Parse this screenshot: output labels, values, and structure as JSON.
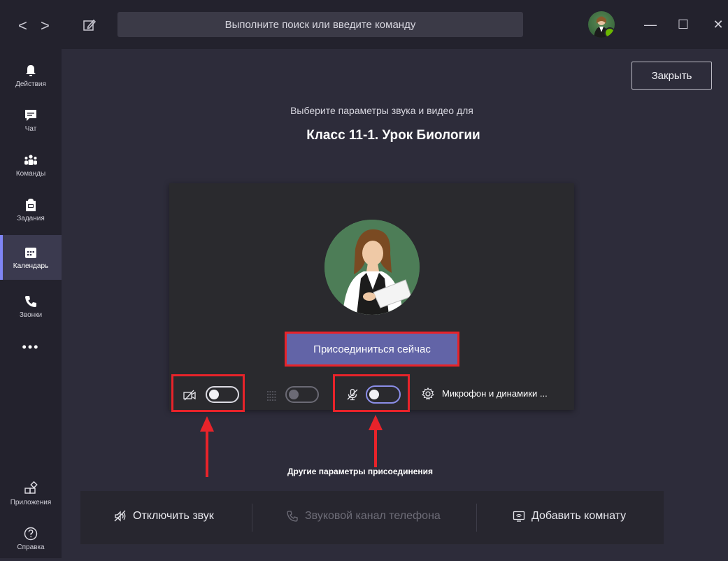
{
  "titlebar": {
    "back_glyph": "<",
    "forward_glyph": ">",
    "search_placeholder": "Выполните поиск или введите команду",
    "minimize_glyph": "—",
    "maximize_glyph": "☐",
    "close_glyph": "✕"
  },
  "rail": {
    "items": [
      {
        "label": "Действия",
        "icon": "bell-icon"
      },
      {
        "label": "Чат",
        "icon": "chat-icon"
      },
      {
        "label": "Команды",
        "icon": "teams-icon"
      },
      {
        "label": "Задания",
        "icon": "assignments-icon"
      },
      {
        "label": "Календарь",
        "icon": "calendar-icon",
        "active": true
      },
      {
        "label": "Звонки",
        "icon": "phone-icon"
      }
    ],
    "more_glyph": "•••",
    "apps_label": "Приложения",
    "help_label": "Справка"
  },
  "meeting": {
    "close_label": "Закрыть",
    "subtitle": "Выберите параметры звука и видео для",
    "title": "Класс 11-1. Урок Биологии",
    "join_label": "Присоединиться сейчас",
    "devices_label": "Микрофон и динамики ...",
    "other_options_label": "Другие параметры присоединения"
  },
  "bottom_bar": {
    "mute_label": "Отключить звук",
    "phone_audio_label": "Звуковой канал телефона",
    "add_room_label": "Добавить комнату"
  },
  "colors": {
    "accent": "#6264a7",
    "highlight": "#e8232a",
    "background": "#2d2c3a",
    "rail": "#23222d"
  }
}
